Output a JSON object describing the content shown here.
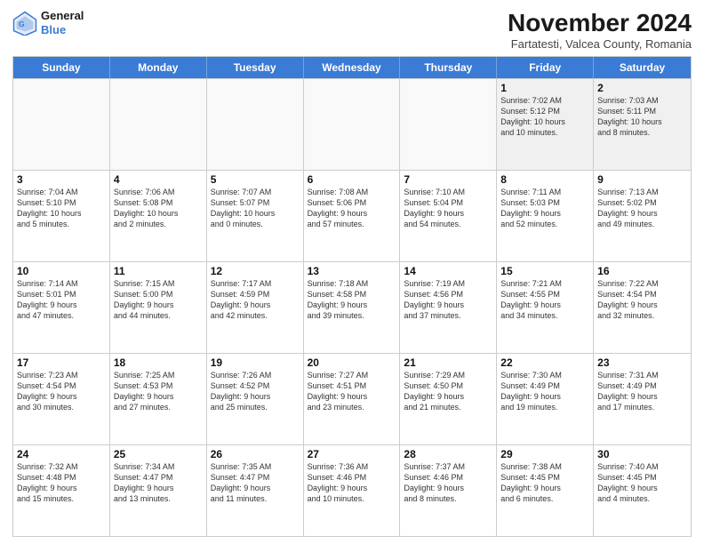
{
  "logo": {
    "line1": "General",
    "line2": "Blue"
  },
  "title": "November 2024",
  "location": "Fartatesti, Valcea County, Romania",
  "header_days": [
    "Sunday",
    "Monday",
    "Tuesday",
    "Wednesday",
    "Thursday",
    "Friday",
    "Saturday"
  ],
  "weeks": [
    [
      {
        "day": "",
        "info": ""
      },
      {
        "day": "",
        "info": ""
      },
      {
        "day": "",
        "info": ""
      },
      {
        "day": "",
        "info": ""
      },
      {
        "day": "",
        "info": ""
      },
      {
        "day": "1",
        "info": "Sunrise: 7:02 AM\nSunset: 5:12 PM\nDaylight: 10 hours\nand 10 minutes."
      },
      {
        "day": "2",
        "info": "Sunrise: 7:03 AM\nSunset: 5:11 PM\nDaylight: 10 hours\nand 8 minutes."
      }
    ],
    [
      {
        "day": "3",
        "info": "Sunrise: 7:04 AM\nSunset: 5:10 PM\nDaylight: 10 hours\nand 5 minutes."
      },
      {
        "day": "4",
        "info": "Sunrise: 7:06 AM\nSunset: 5:08 PM\nDaylight: 10 hours\nand 2 minutes."
      },
      {
        "day": "5",
        "info": "Sunrise: 7:07 AM\nSunset: 5:07 PM\nDaylight: 10 hours\nand 0 minutes."
      },
      {
        "day": "6",
        "info": "Sunrise: 7:08 AM\nSunset: 5:06 PM\nDaylight: 9 hours\nand 57 minutes."
      },
      {
        "day": "7",
        "info": "Sunrise: 7:10 AM\nSunset: 5:04 PM\nDaylight: 9 hours\nand 54 minutes."
      },
      {
        "day": "8",
        "info": "Sunrise: 7:11 AM\nSunset: 5:03 PM\nDaylight: 9 hours\nand 52 minutes."
      },
      {
        "day": "9",
        "info": "Sunrise: 7:13 AM\nSunset: 5:02 PM\nDaylight: 9 hours\nand 49 minutes."
      }
    ],
    [
      {
        "day": "10",
        "info": "Sunrise: 7:14 AM\nSunset: 5:01 PM\nDaylight: 9 hours\nand 47 minutes."
      },
      {
        "day": "11",
        "info": "Sunrise: 7:15 AM\nSunset: 5:00 PM\nDaylight: 9 hours\nand 44 minutes."
      },
      {
        "day": "12",
        "info": "Sunrise: 7:17 AM\nSunset: 4:59 PM\nDaylight: 9 hours\nand 42 minutes."
      },
      {
        "day": "13",
        "info": "Sunrise: 7:18 AM\nSunset: 4:58 PM\nDaylight: 9 hours\nand 39 minutes."
      },
      {
        "day": "14",
        "info": "Sunrise: 7:19 AM\nSunset: 4:56 PM\nDaylight: 9 hours\nand 37 minutes."
      },
      {
        "day": "15",
        "info": "Sunrise: 7:21 AM\nSunset: 4:55 PM\nDaylight: 9 hours\nand 34 minutes."
      },
      {
        "day": "16",
        "info": "Sunrise: 7:22 AM\nSunset: 4:54 PM\nDaylight: 9 hours\nand 32 minutes."
      }
    ],
    [
      {
        "day": "17",
        "info": "Sunrise: 7:23 AM\nSunset: 4:54 PM\nDaylight: 9 hours\nand 30 minutes."
      },
      {
        "day": "18",
        "info": "Sunrise: 7:25 AM\nSunset: 4:53 PM\nDaylight: 9 hours\nand 27 minutes."
      },
      {
        "day": "19",
        "info": "Sunrise: 7:26 AM\nSunset: 4:52 PM\nDaylight: 9 hours\nand 25 minutes."
      },
      {
        "day": "20",
        "info": "Sunrise: 7:27 AM\nSunset: 4:51 PM\nDaylight: 9 hours\nand 23 minutes."
      },
      {
        "day": "21",
        "info": "Sunrise: 7:29 AM\nSunset: 4:50 PM\nDaylight: 9 hours\nand 21 minutes."
      },
      {
        "day": "22",
        "info": "Sunrise: 7:30 AM\nSunset: 4:49 PM\nDaylight: 9 hours\nand 19 minutes."
      },
      {
        "day": "23",
        "info": "Sunrise: 7:31 AM\nSunset: 4:49 PM\nDaylight: 9 hours\nand 17 minutes."
      }
    ],
    [
      {
        "day": "24",
        "info": "Sunrise: 7:32 AM\nSunset: 4:48 PM\nDaylight: 9 hours\nand 15 minutes."
      },
      {
        "day": "25",
        "info": "Sunrise: 7:34 AM\nSunset: 4:47 PM\nDaylight: 9 hours\nand 13 minutes."
      },
      {
        "day": "26",
        "info": "Sunrise: 7:35 AM\nSunset: 4:47 PM\nDaylight: 9 hours\nand 11 minutes."
      },
      {
        "day": "27",
        "info": "Sunrise: 7:36 AM\nSunset: 4:46 PM\nDaylight: 9 hours\nand 10 minutes."
      },
      {
        "day": "28",
        "info": "Sunrise: 7:37 AM\nSunset: 4:46 PM\nDaylight: 9 hours\nand 8 minutes."
      },
      {
        "day": "29",
        "info": "Sunrise: 7:38 AM\nSunset: 4:45 PM\nDaylight: 9 hours\nand 6 minutes."
      },
      {
        "day": "30",
        "info": "Sunrise: 7:40 AM\nSunset: 4:45 PM\nDaylight: 9 hours\nand 4 minutes."
      }
    ]
  ]
}
